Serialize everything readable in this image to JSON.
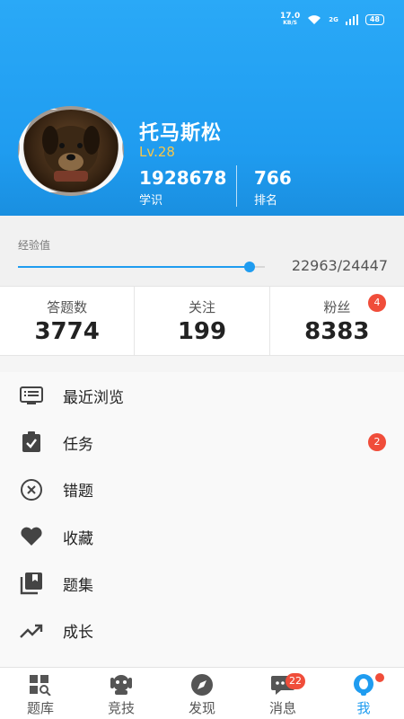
{
  "status_bar": {
    "speed": "17.0",
    "speed_unit": "KB/S",
    "network": "2G",
    "battery": "48"
  },
  "profile": {
    "name": "托马斯松",
    "level": "Lv.28",
    "knowledge_value": "1928678",
    "knowledge_label": "学识",
    "rank_value": "766",
    "rank_label": "排名"
  },
  "experience": {
    "label": "经验值",
    "current": 22963,
    "max": 24447,
    "text": "22963/24447"
  },
  "counts": [
    {
      "label": "答题数",
      "value": "3774"
    },
    {
      "label": "关注",
      "value": "199"
    },
    {
      "label": "粉丝",
      "value": "8383",
      "badge": "4"
    }
  ],
  "menu": [
    {
      "label": "最近浏览",
      "icon": "browse-history-icon"
    },
    {
      "label": "任务",
      "icon": "task-clipboard-icon",
      "badge": "2"
    },
    {
      "label": "错题",
      "icon": "wrong-question-icon"
    },
    {
      "label": "收藏",
      "icon": "heart-icon"
    },
    {
      "label": "题集",
      "icon": "question-set-icon"
    },
    {
      "label": "成长",
      "icon": "growth-trend-icon"
    }
  ],
  "tabs": [
    {
      "label": "题库",
      "icon": "question-bank-icon"
    },
    {
      "label": "竞技",
      "icon": "competition-icon"
    },
    {
      "label": "发现",
      "icon": "compass-icon"
    },
    {
      "label": "消息",
      "icon": "message-icon",
      "badge": "22"
    },
    {
      "label": "我",
      "icon": "me-icon",
      "active": true
    }
  ],
  "colors": {
    "primary": "#1f9cf0",
    "badge": "#f04d3a",
    "level": "#f6c64a"
  }
}
